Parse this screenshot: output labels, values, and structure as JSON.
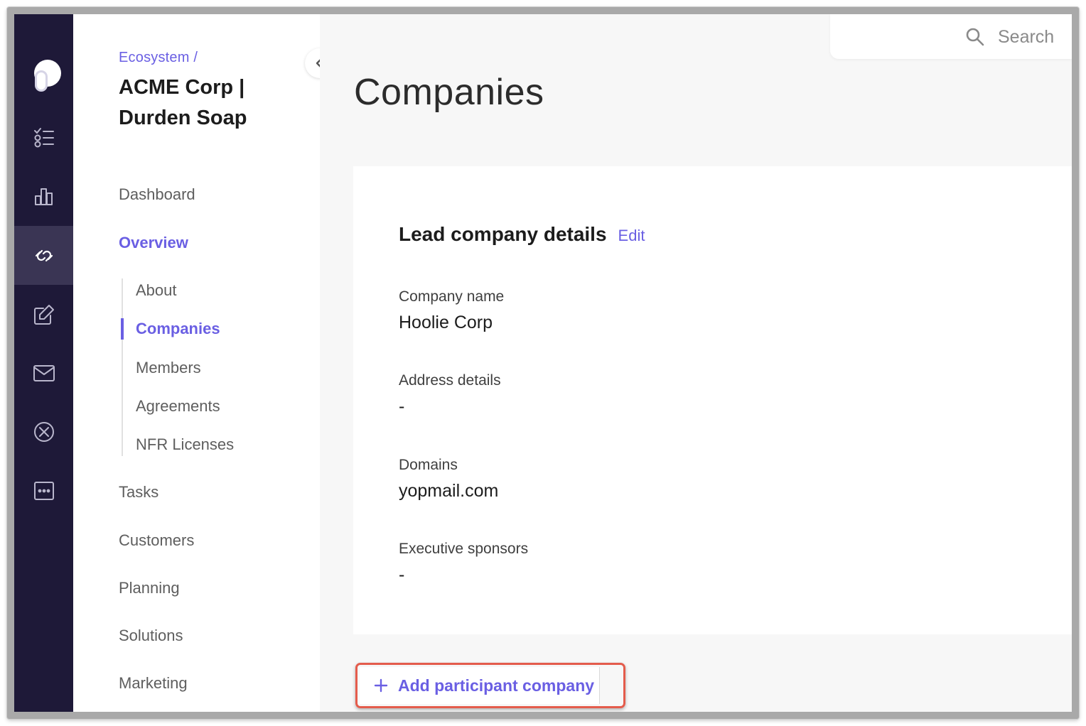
{
  "breadcrumb": "Ecosystem /",
  "project_title": "ACME Corp | Durden Soap",
  "rail": {
    "icons": [
      "app-logo-icon",
      "checklist-icon",
      "bar-chart-icon",
      "link-icon",
      "edit-icon",
      "mail-icon",
      "cancel-circle-icon",
      "more-icon"
    ],
    "active": "link-icon"
  },
  "nav": {
    "items": [
      {
        "label": "Dashboard",
        "active": false
      },
      {
        "label": "Overview",
        "active": true
      },
      {
        "label": "Tasks",
        "active": false
      },
      {
        "label": "Customers",
        "active": false
      },
      {
        "label": "Planning",
        "active": false
      },
      {
        "label": "Solutions",
        "active": false
      },
      {
        "label": "Marketing",
        "active": false
      }
    ],
    "sub_items": [
      {
        "label": "About",
        "active": false
      },
      {
        "label": "Companies",
        "active": true
      },
      {
        "label": "Members",
        "active": false
      },
      {
        "label": "Agreements",
        "active": false
      },
      {
        "label": "NFR Licenses",
        "active": false
      }
    ]
  },
  "search": {
    "placeholder": "Search"
  },
  "page_title": "Companies",
  "card": {
    "title": "Lead company details",
    "edit_label": "Edit",
    "fields": [
      {
        "label": "Company name",
        "value": "Hoolie Corp"
      },
      {
        "label": "Address details",
        "value": "-"
      },
      {
        "label": "Domains",
        "value": "yopmail.com"
      },
      {
        "label": "Executive sponsors",
        "value": "-"
      }
    ]
  },
  "add_button": {
    "label": "Add participant company"
  },
  "colors": {
    "accent": "#6a5fe3",
    "rail_bg": "#1e1938",
    "rail_active": "#3a3554",
    "highlight": "#e45c4c"
  }
}
